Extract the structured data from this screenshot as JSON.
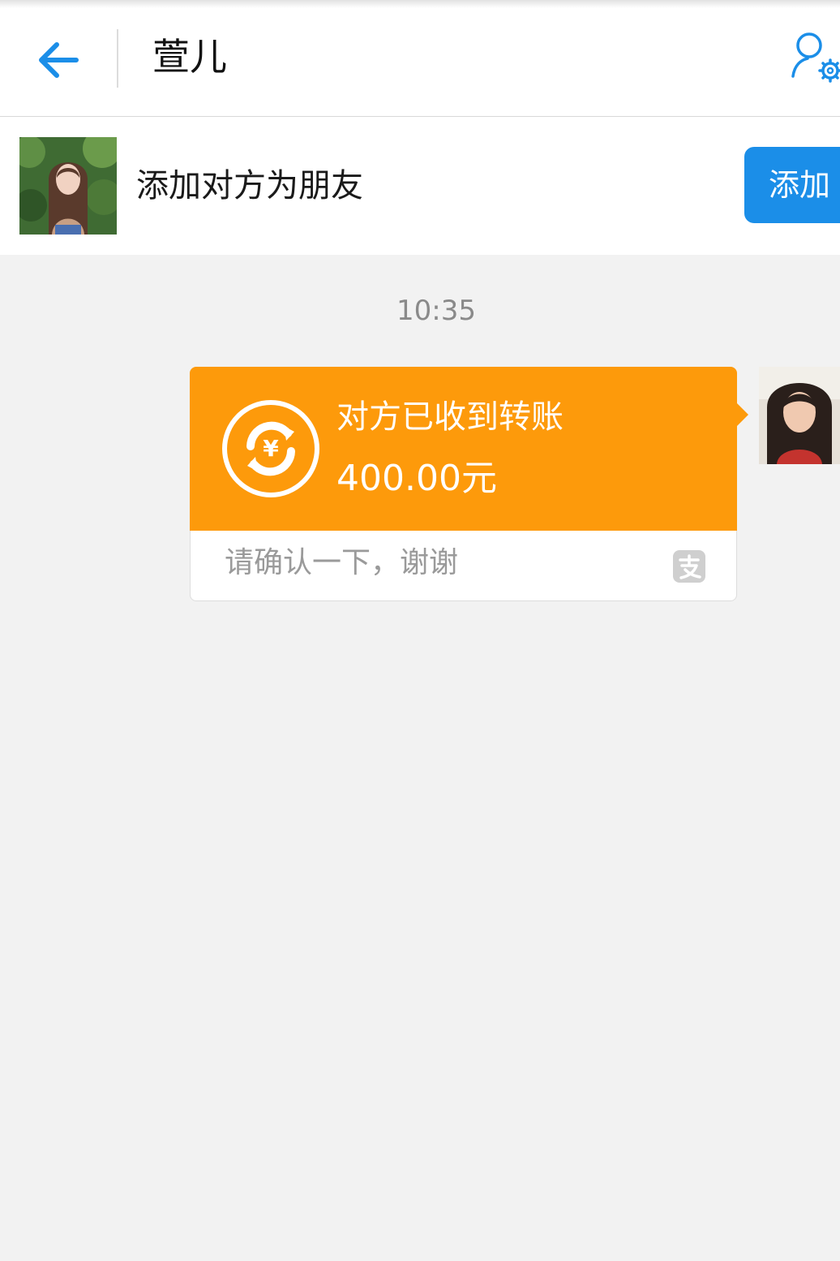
{
  "header": {
    "title": "萱儿"
  },
  "add_friend": {
    "prompt": "添加对方为朋友",
    "button_label": "添加"
  },
  "chat": {
    "timestamp": "10:35",
    "transfer": {
      "status": "对方已收到转账",
      "amount": "400.00元",
      "note": "请确认一下，谢谢"
    }
  },
  "icons": {
    "back": "arrow-left-icon",
    "profile_settings": "user-settings-icon",
    "transfer": "yuan-refresh-icon",
    "alipay": "alipay-logo-icon"
  },
  "colors": {
    "accent_blue": "#1b8ee8",
    "transfer_orange": "#fd9a0b",
    "background": "#f2f2f2"
  }
}
